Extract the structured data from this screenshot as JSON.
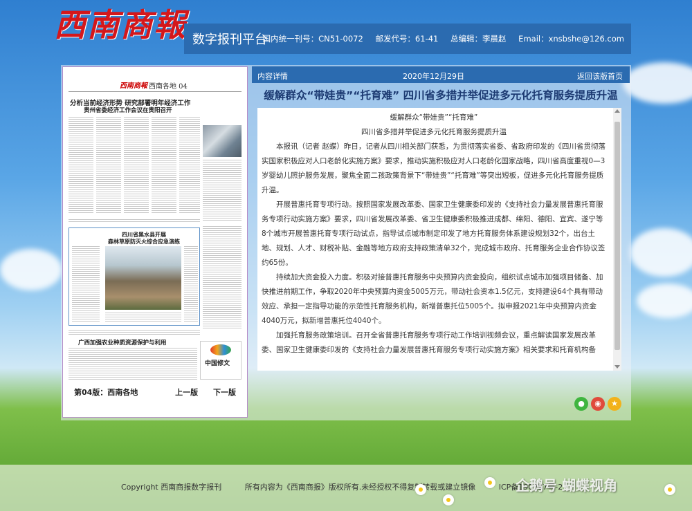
{
  "header": {
    "logo_text": "西南商報",
    "platform_title": "数字报刊平台",
    "issn": "国内统一刊号：CN51-0072",
    "postal_code": "邮发代号：61-41",
    "editor": "总编辑：李晨赵",
    "email": "Email：xnsbshe@126.com"
  },
  "newspaper_thumb": {
    "mini_logo": "西南商報",
    "section": "西南各地 04",
    "headline_1": "分析当前经济形势 研究部署明年经济工作",
    "headline_1b": "贵州省委经济工作会议在贵阳召开",
    "headline_2": "四川省黑水县开展",
    "headline_2b": "森林草原防灭火综合应急演练",
    "headline_3": "广西加强农业种质资源保护与利用",
    "page_label": "第04版：西南各地",
    "prev_label": "上一版",
    "next_label": "下一版"
  },
  "article_bar": {
    "label": "内容详情",
    "date": "2020年12月29日",
    "back_label": "返回该版首页"
  },
  "article": {
    "title": "缓解群众“带娃贵”“托育难” 四川省多措并举促进多元化托育服务提质升温",
    "subtitle_1": "缓解群众“带娃贵”“托育难”",
    "subtitle_2": "四川省多措并举促进多元化托育服务提质升温",
    "para_1": "本报讯（记者 赵蝶）昨日，记者从四川相关部门获悉，为贯彻落实省委、省政府印发的《四川省贯彻落实国家积极应对人口老龄化实施方案》要求，推动实施积极应对人口老龄化国家战略，四川省高度重视0—3岁婴幼儿照护服务发展，聚焦全面二孩政策背景下“带娃贵”“托育难”等突出短板，促进多元化托育服务提质升温。",
    "para_2": "开展普惠托育专项行动。按照国家发展改革委、国家卫生健康委印发的《支持社会力量发展普惠托育服务专项行动实施方案》要求，四川省发展改革委、省卫生健康委积极推进成都、绵阳、德阳、宜宾、遂宁等8个城市开展普惠托育专项行动试点，指导试点城市制定印发了地方托育服务体系建设规划32个，出台土地、规划、人才、财税补贴、金融等地方政府支持政策清单32个，完成城市政府、托育服务企业合作协议签约65份。",
    "para_3": "持续加大资金投入力度。积极对接普惠托育服务中央预算内资金投向，组织试点城市加强项目储备、加快推进前期工作，争取2020年中央预算内资金5005万元，带动社会资本1.5亿元，支持建设64个具有带动效应、承担一定指导功能的示范性托育服务机构，新增普惠托位5005个。拟申报2021年中央预算内资金4040万元，拟新增普惠托位4040个。",
    "para_4": "加强托育服务政策培训。召开全省普惠托育服务专项行动工作培训视频会议，重点解读国家发展改革委、国家卫生健康委印发的《支持社会力量发展普惠托育服务专项行动实施方案》相关要求和托育机构备"
  },
  "footer": {
    "copyright": "Copyright 西南商报数字报刊",
    "rights": "所有内容为《西南商报》版权所有.未经授权不得复制转载或建立镜像",
    "icp": "ICP备190397号-2",
    "watermark": "企鹅号 蝴蝶视角"
  },
  "colors": {
    "brand_red": "#d4171b",
    "bar_blue": "#2b6bb0",
    "title_blue": "#1c3a72"
  }
}
